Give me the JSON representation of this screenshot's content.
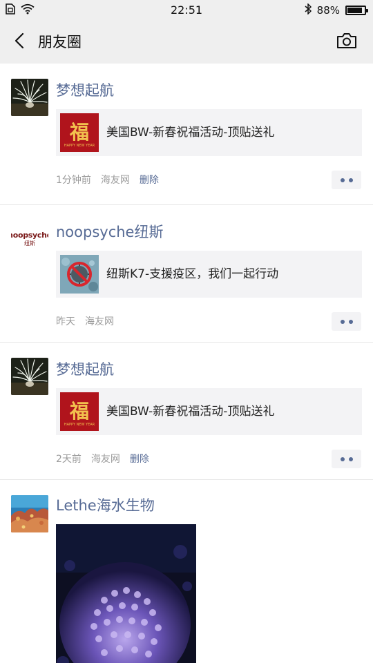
{
  "status_bar": {
    "time": "22:51",
    "battery_text": "88%",
    "battery_level": 0.88,
    "icons": [
      "sim-icon",
      "wifi-icon",
      "bluetooth-icon",
      "battery-icon"
    ]
  },
  "nav": {
    "back_icon": "chevron-left-icon",
    "title": "朋友圈",
    "camera_icon": "camera-icon"
  },
  "colors": {
    "name_blue": "#576b95",
    "bar_bg": "#efefef",
    "card_bg": "#f3f3f5",
    "meta_gray": "#9b9b9b"
  },
  "posts": [
    {
      "author": "梦想起航",
      "avatar": "sea-anemone-photo",
      "link_title": "美国BW-新春祝福活动-顶贴送礼",
      "link_thumb": "fu-character-red-card",
      "thumb_text": "福",
      "thumb_subtext": "HAPPY NEW YEAR",
      "time": "1分钟前",
      "source": "海友网",
      "delete": "删除"
    },
    {
      "author": "noopsyche纽斯",
      "avatar": "noopsyche-logo",
      "avatar_text_1": "noopsyche",
      "avatar_text_2": "纽斯",
      "link_title": "纽斯K7-支援疫区，我们一起行动",
      "link_thumb": "no-virus-sign",
      "time": "昨天",
      "source": "海友网"
    },
    {
      "author": "梦想起航",
      "avatar": "sea-anemone-photo",
      "link_title": "美国BW-新春祝福活动-顶贴送礼",
      "link_thumb": "fu-character-red-card",
      "thumb_text": "福",
      "thumb_subtext": "HAPPY NEW YEAR",
      "time": "2天前",
      "source": "海友网",
      "delete": "删除"
    },
    {
      "author": "Lethe海水生物",
      "avatar": "coral-reef-photo",
      "image": "purple-coral-aquarium-photo"
    }
  ]
}
